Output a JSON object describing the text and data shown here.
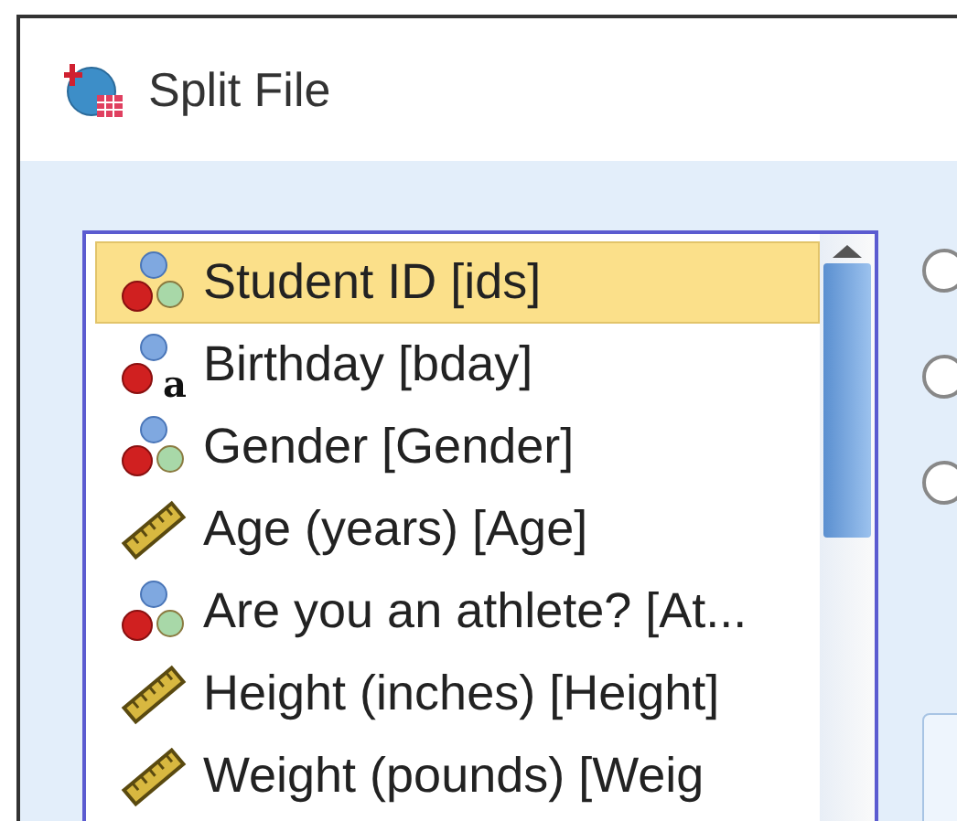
{
  "window": {
    "title": "Split File"
  },
  "variables": [
    {
      "label": "Student ID [ids]",
      "kind": "nominal",
      "selected": true
    },
    {
      "label": "Birthday [bday]",
      "kind": "string",
      "icon_letter": "a",
      "selected": false
    },
    {
      "label": "Gender [Gender]",
      "kind": "nominal",
      "selected": false
    },
    {
      "label": "Age (years) [Age]",
      "kind": "scale",
      "selected": false
    },
    {
      "label": "Are you an athlete? [At...",
      "kind": "nominal",
      "selected": false
    },
    {
      "label": "Height (inches) [Height]",
      "kind": "scale",
      "selected": false
    },
    {
      "label": "Weight (pounds) [Weig",
      "kind": "scale",
      "selected": false
    }
  ],
  "options": [
    {
      "selected": false
    },
    {
      "selected": false
    },
    {
      "selected": false
    }
  ]
}
